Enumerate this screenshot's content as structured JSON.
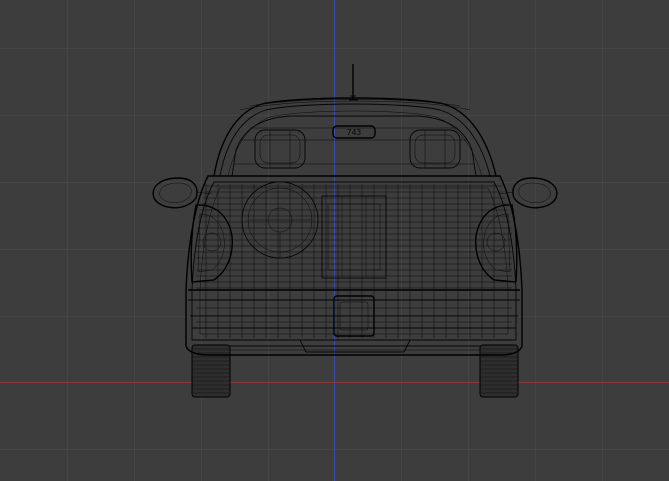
{
  "viewport": {
    "view": "rear-orthographic",
    "shading": "wireframe",
    "colors": {
      "background": "#3d3d3d",
      "axis_vertical": "#3a4fa8",
      "axis_horizontal": "#8a3a3a",
      "wireframe": "#050505"
    }
  },
  "model": {
    "plate_text": "743"
  }
}
